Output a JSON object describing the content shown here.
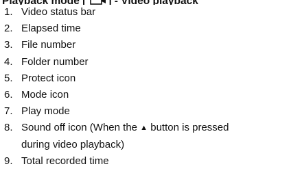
{
  "heading": {
    "prefix": "Playback mode [",
    "suffix": "] - Video playback",
    "mode_icon": "video-playback-mode-icon"
  },
  "items": [
    {
      "number": "1.",
      "text": "Video status bar"
    },
    {
      "number": "2.",
      "text": "Elapsed time"
    },
    {
      "number": "3.",
      "text": "File number"
    },
    {
      "number": "4.",
      "text": "Folder number"
    },
    {
      "number": "5.",
      "text": "Protect icon"
    },
    {
      "number": "6.",
      "text": "Mode icon"
    },
    {
      "number": "7.",
      "text": "Play mode"
    },
    {
      "number": "8.",
      "text_before": "Sound off icon (When the",
      "glyph": "▲",
      "text_after": "button is pressed",
      "text_cont": "during video playback)"
    },
    {
      "number": "9.",
      "text": "Total recorded time"
    }
  ]
}
